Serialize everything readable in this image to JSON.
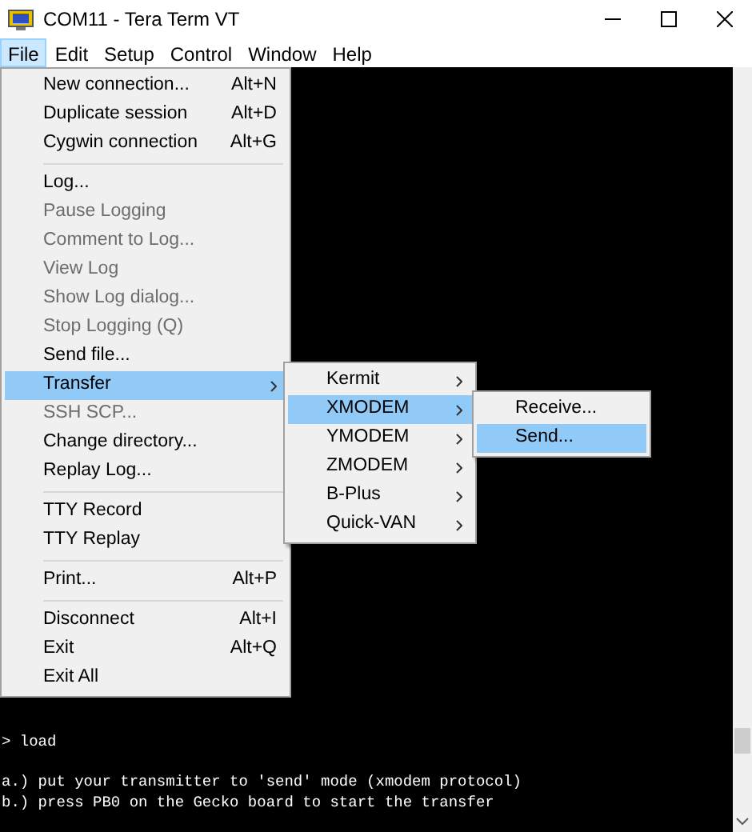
{
  "window": {
    "title": "COM11 - Tera Term VT"
  },
  "menubar": {
    "items": [
      {
        "label": "File",
        "selected": true
      },
      {
        "label": "Edit",
        "selected": false
      },
      {
        "label": "Setup",
        "selected": false
      },
      {
        "label": "Control",
        "selected": false
      },
      {
        "label": "Window",
        "selected": false
      },
      {
        "label": "Help",
        "selected": false
      }
    ]
  },
  "file_menu": {
    "items": [
      {
        "kind": "item",
        "label": "New connection...",
        "shortcut": "Alt+N",
        "disabled": false,
        "selected": false,
        "has_submenu": false
      },
      {
        "kind": "item",
        "label": "Duplicate session",
        "shortcut": "Alt+D",
        "disabled": false,
        "selected": false,
        "has_submenu": false
      },
      {
        "kind": "item",
        "label": "Cygwin connection",
        "shortcut": "Alt+G",
        "disabled": false,
        "selected": false,
        "has_submenu": false
      },
      {
        "kind": "separator"
      },
      {
        "kind": "item",
        "label": "Log...",
        "disabled": false,
        "selected": false,
        "has_submenu": false
      },
      {
        "kind": "item",
        "label": "Pause Logging",
        "disabled": true,
        "selected": false,
        "has_submenu": false
      },
      {
        "kind": "item",
        "label": "Comment to Log...",
        "disabled": true,
        "selected": false,
        "has_submenu": false
      },
      {
        "kind": "item",
        "label": "View Log",
        "disabled": true,
        "selected": false,
        "has_submenu": false
      },
      {
        "kind": "item",
        "label": "Show Log dialog...",
        "disabled": true,
        "selected": false,
        "has_submenu": false
      },
      {
        "kind": "item",
        "label": "Stop Logging (Q)",
        "disabled": true,
        "selected": false,
        "has_submenu": false
      },
      {
        "kind": "item",
        "label": "Send file...",
        "disabled": false,
        "selected": false,
        "has_submenu": false
      },
      {
        "kind": "item",
        "label": "Transfer",
        "disabled": false,
        "selected": true,
        "has_submenu": true
      },
      {
        "kind": "item",
        "label": "SSH SCP...",
        "disabled": true,
        "selected": false,
        "has_submenu": false
      },
      {
        "kind": "item",
        "label": "Change directory...",
        "disabled": false,
        "selected": false,
        "has_submenu": false
      },
      {
        "kind": "item",
        "label": "Replay Log...",
        "disabled": false,
        "selected": false,
        "has_submenu": false
      },
      {
        "kind": "separator"
      },
      {
        "kind": "item",
        "label": "TTY Record",
        "disabled": false,
        "selected": false,
        "has_submenu": false
      },
      {
        "kind": "item",
        "label": "TTY Replay",
        "disabled": false,
        "selected": false,
        "has_submenu": false
      },
      {
        "kind": "separator"
      },
      {
        "kind": "item",
        "label": "Print...",
        "shortcut": "Alt+P",
        "disabled": false,
        "selected": false,
        "has_submenu": false
      },
      {
        "kind": "separator"
      },
      {
        "kind": "item",
        "label": "Disconnect",
        "shortcut": "Alt+I",
        "disabled": false,
        "selected": false,
        "has_submenu": false
      },
      {
        "kind": "item",
        "label": "Exit",
        "shortcut": "Alt+Q",
        "disabled": false,
        "selected": false,
        "has_submenu": false
      },
      {
        "kind": "item",
        "label": "Exit All",
        "disabled": false,
        "selected": false,
        "has_submenu": false
      }
    ]
  },
  "transfer_menu": {
    "items": [
      {
        "kind": "item",
        "label": "Kermit",
        "disabled": false,
        "selected": false,
        "has_submenu": true
      },
      {
        "kind": "item",
        "label": "XMODEM",
        "disabled": false,
        "selected": true,
        "has_submenu": true
      },
      {
        "kind": "item",
        "label": "YMODEM",
        "disabled": false,
        "selected": false,
        "has_submenu": true
      },
      {
        "kind": "item",
        "label": "ZMODEM",
        "disabled": false,
        "selected": false,
        "has_submenu": true
      },
      {
        "kind": "item",
        "label": "B-Plus",
        "disabled": false,
        "selected": false,
        "has_submenu": true
      },
      {
        "kind": "item",
        "label": "Quick-VAN",
        "disabled": false,
        "selected": false,
        "has_submenu": true
      }
    ]
  },
  "xmodem_menu": {
    "items": [
      {
        "kind": "item",
        "label": "Receive...",
        "disabled": false,
        "selected": false,
        "has_submenu": false
      },
      {
        "kind": "item",
        "label": "Send...",
        "disabled": false,
        "selected": true,
        "has_submenu": false
      }
    ]
  },
  "terminal": {
    "blocks": [
      [
        "> load"
      ],
      [
        "a.) put your transmitter to 'send' mode (xmodem protocol)",
        "b.) press PB0 on the Gecko board to start the transfer"
      ]
    ]
  }
}
